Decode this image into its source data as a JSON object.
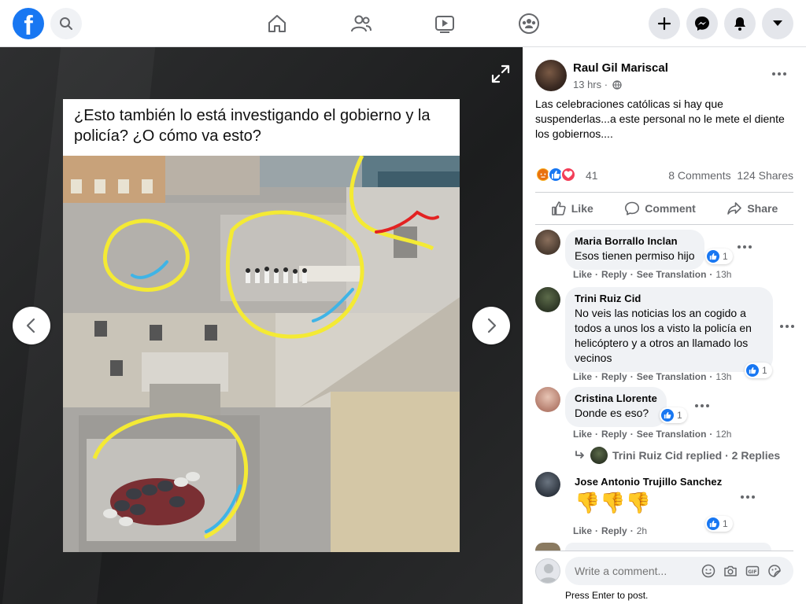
{
  "topbar": {
    "logo": "f",
    "icons": [
      "facebook-logo",
      "search-icon",
      "home-icon",
      "friends-icon",
      "watch-icon",
      "groups-icon",
      "plus-icon",
      "messenger-icon",
      "notifications-icon",
      "account-menu-icon"
    ]
  },
  "meme": {
    "caption": "¿Esto también lo está investigando el gobierno y la policía? ¿O cómo  va esto?"
  },
  "post": {
    "author": "Raul Gil Mariscal",
    "time": "13 hrs ·",
    "text": "Las celebraciones católicas si hay que suspenderlas...a este personal no le mete el diente los gobiernos....",
    "reaction_count": "41",
    "comments_count": "8 Comments",
    "shares_count": "124 Shares",
    "actions": {
      "like": "Like",
      "comment": "Comment",
      "share": "Share"
    }
  },
  "comments": [
    {
      "name": "Maria Borrallo Inclan",
      "text": "Esos tienen permiso hijo",
      "likes": "1",
      "like": "Like",
      "reply": "Reply",
      "translate": "See Translation",
      "time": "13h"
    },
    {
      "name": "Trini Ruiz Cid",
      "text": "No veis las noticias los an cogido a todos a unos los a visto la policía en helicóptero y a otros an llamado los vecinos",
      "likes": "1",
      "like": "Like",
      "reply": "Reply",
      "translate": "See Translation",
      "time": "13h"
    },
    {
      "name": "Cristina Llorente",
      "text": "Donde es eso?",
      "likes": "1",
      "like": "Like",
      "reply": "Reply",
      "translate": "See Translation",
      "time": "12h"
    },
    {
      "name": "Jose Antonio Trujillo Sanchez",
      "text": "👎👎👎",
      "likes": "1",
      "like": "Like",
      "reply": "Reply",
      "time": "2h"
    }
  ],
  "replies_line": "Trini Ruiz Cid replied · 2 Replies",
  "write_comment": {
    "placeholder": "Write a comment...",
    "hint": "Press Enter to post."
  },
  "colors": {
    "brand": "#1877f2",
    "secondary_text": "#65676b",
    "bubble": "#f0f2f5"
  }
}
